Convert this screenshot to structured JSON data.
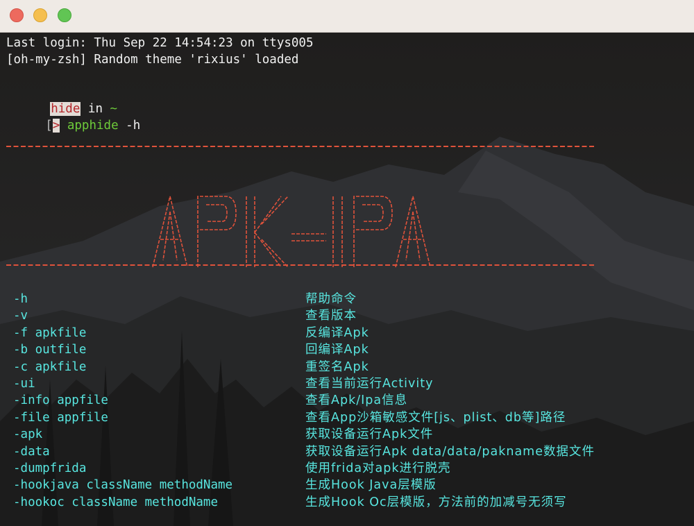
{
  "window": {
    "controls": [
      "close-button",
      "minimize-button",
      "zoom-button"
    ]
  },
  "terminal": {
    "last_login": "Last login: Thu Sep 22 14:54:23 on ttys005",
    "theme_line": "[oh-my-zsh] Random theme 'rixius' loaded",
    "prompt": {
      "user": "hide",
      "in_word": " in ",
      "dir": "~",
      "bracket": "[",
      "symbol": ">",
      "command": "apphide",
      "args": " -h"
    },
    "banner_text": "APK-IPA",
    "options": [
      {
        "flag": "-h",
        "description": "帮助命令"
      },
      {
        "flag": "-v",
        "description": "查看版本"
      },
      {
        "flag": "-f apkfile",
        "description": "反编译Apk"
      },
      {
        "flag": "-b outfile",
        "description": "回编译Apk"
      },
      {
        "flag": "-c apkfile",
        "description": "重签名Apk"
      },
      {
        "flag": "-ui",
        "description": "查看当前运行Activity"
      },
      {
        "flag": "-info appfile",
        "description": "查看Apk/Ipa信息"
      },
      {
        "flag": "-file appfile",
        "description": "查看App沙箱敏感文件[js、plist、db等]路径"
      },
      {
        "flag": "-apk",
        "description": "获取设备运行Apk文件"
      },
      {
        "flag": "-data",
        "description": "获取设备运行Apk data/data/pakname数据文件"
      },
      {
        "flag": "-dumpfrida",
        "description": "使用frida对apk进行脱壳"
      },
      {
        "flag": "-hookjava className methodName",
        "description": "生成Hook Java层模版"
      },
      {
        "flag": "-hookoc className methodName",
        "description": "生成Hook Oc层模版，方法前的加减号无须写"
      }
    ]
  },
  "colors": {
    "accent_cyan": "#58e6e0",
    "prompt_red": "#b4262a",
    "command_green": "#6ecb3a",
    "divider_red": "#e0523b"
  }
}
